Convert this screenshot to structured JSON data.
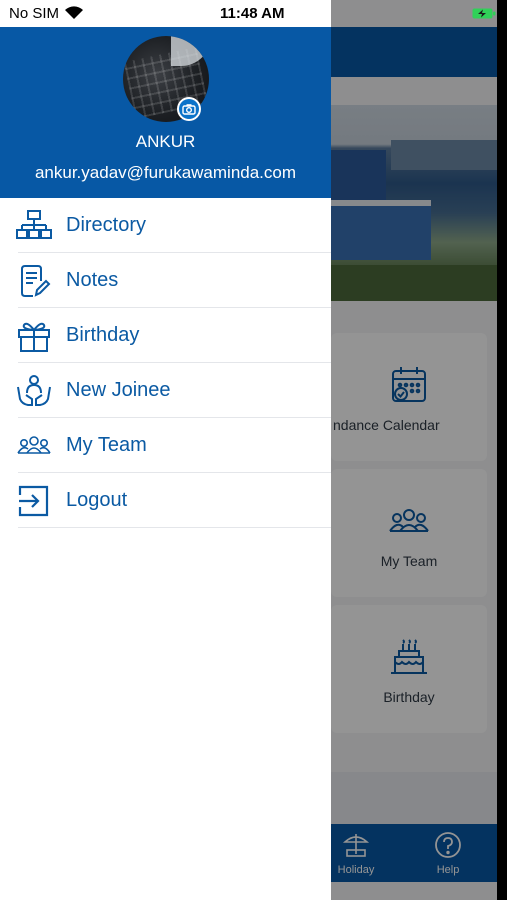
{
  "status_bar": {
    "carrier": "No SIM",
    "time": "11:48 AM"
  },
  "drawer": {
    "user": {
      "name": "ANKUR",
      "email": "ankur.yadav@furukawaminda.com"
    },
    "menu_items": [
      {
        "label": "Directory",
        "icon": "org-chart-icon"
      },
      {
        "label": "Notes",
        "icon": "notes-icon"
      },
      {
        "label": "Birthday",
        "icon": "gift-icon"
      },
      {
        "label": "New Joinee",
        "icon": "new-joinee-icon"
      },
      {
        "label": "My Team",
        "icon": "team-icon"
      },
      {
        "label": "Logout",
        "icon": "logout-icon"
      }
    ]
  },
  "background": {
    "cards": [
      {
        "label": "ndance Calendar",
        "icon": "calendar-icon"
      },
      {
        "label": "My Team",
        "icon": "team-icon"
      },
      {
        "label": "Birthday",
        "icon": "cake-icon"
      }
    ],
    "tabs": [
      {
        "label": "Holiday",
        "icon": "holiday-icon"
      },
      {
        "label": "Help",
        "icon": "help-icon"
      }
    ]
  },
  "colors": {
    "brand": "#0758a5",
    "menu_text": "#0b5aa3"
  }
}
